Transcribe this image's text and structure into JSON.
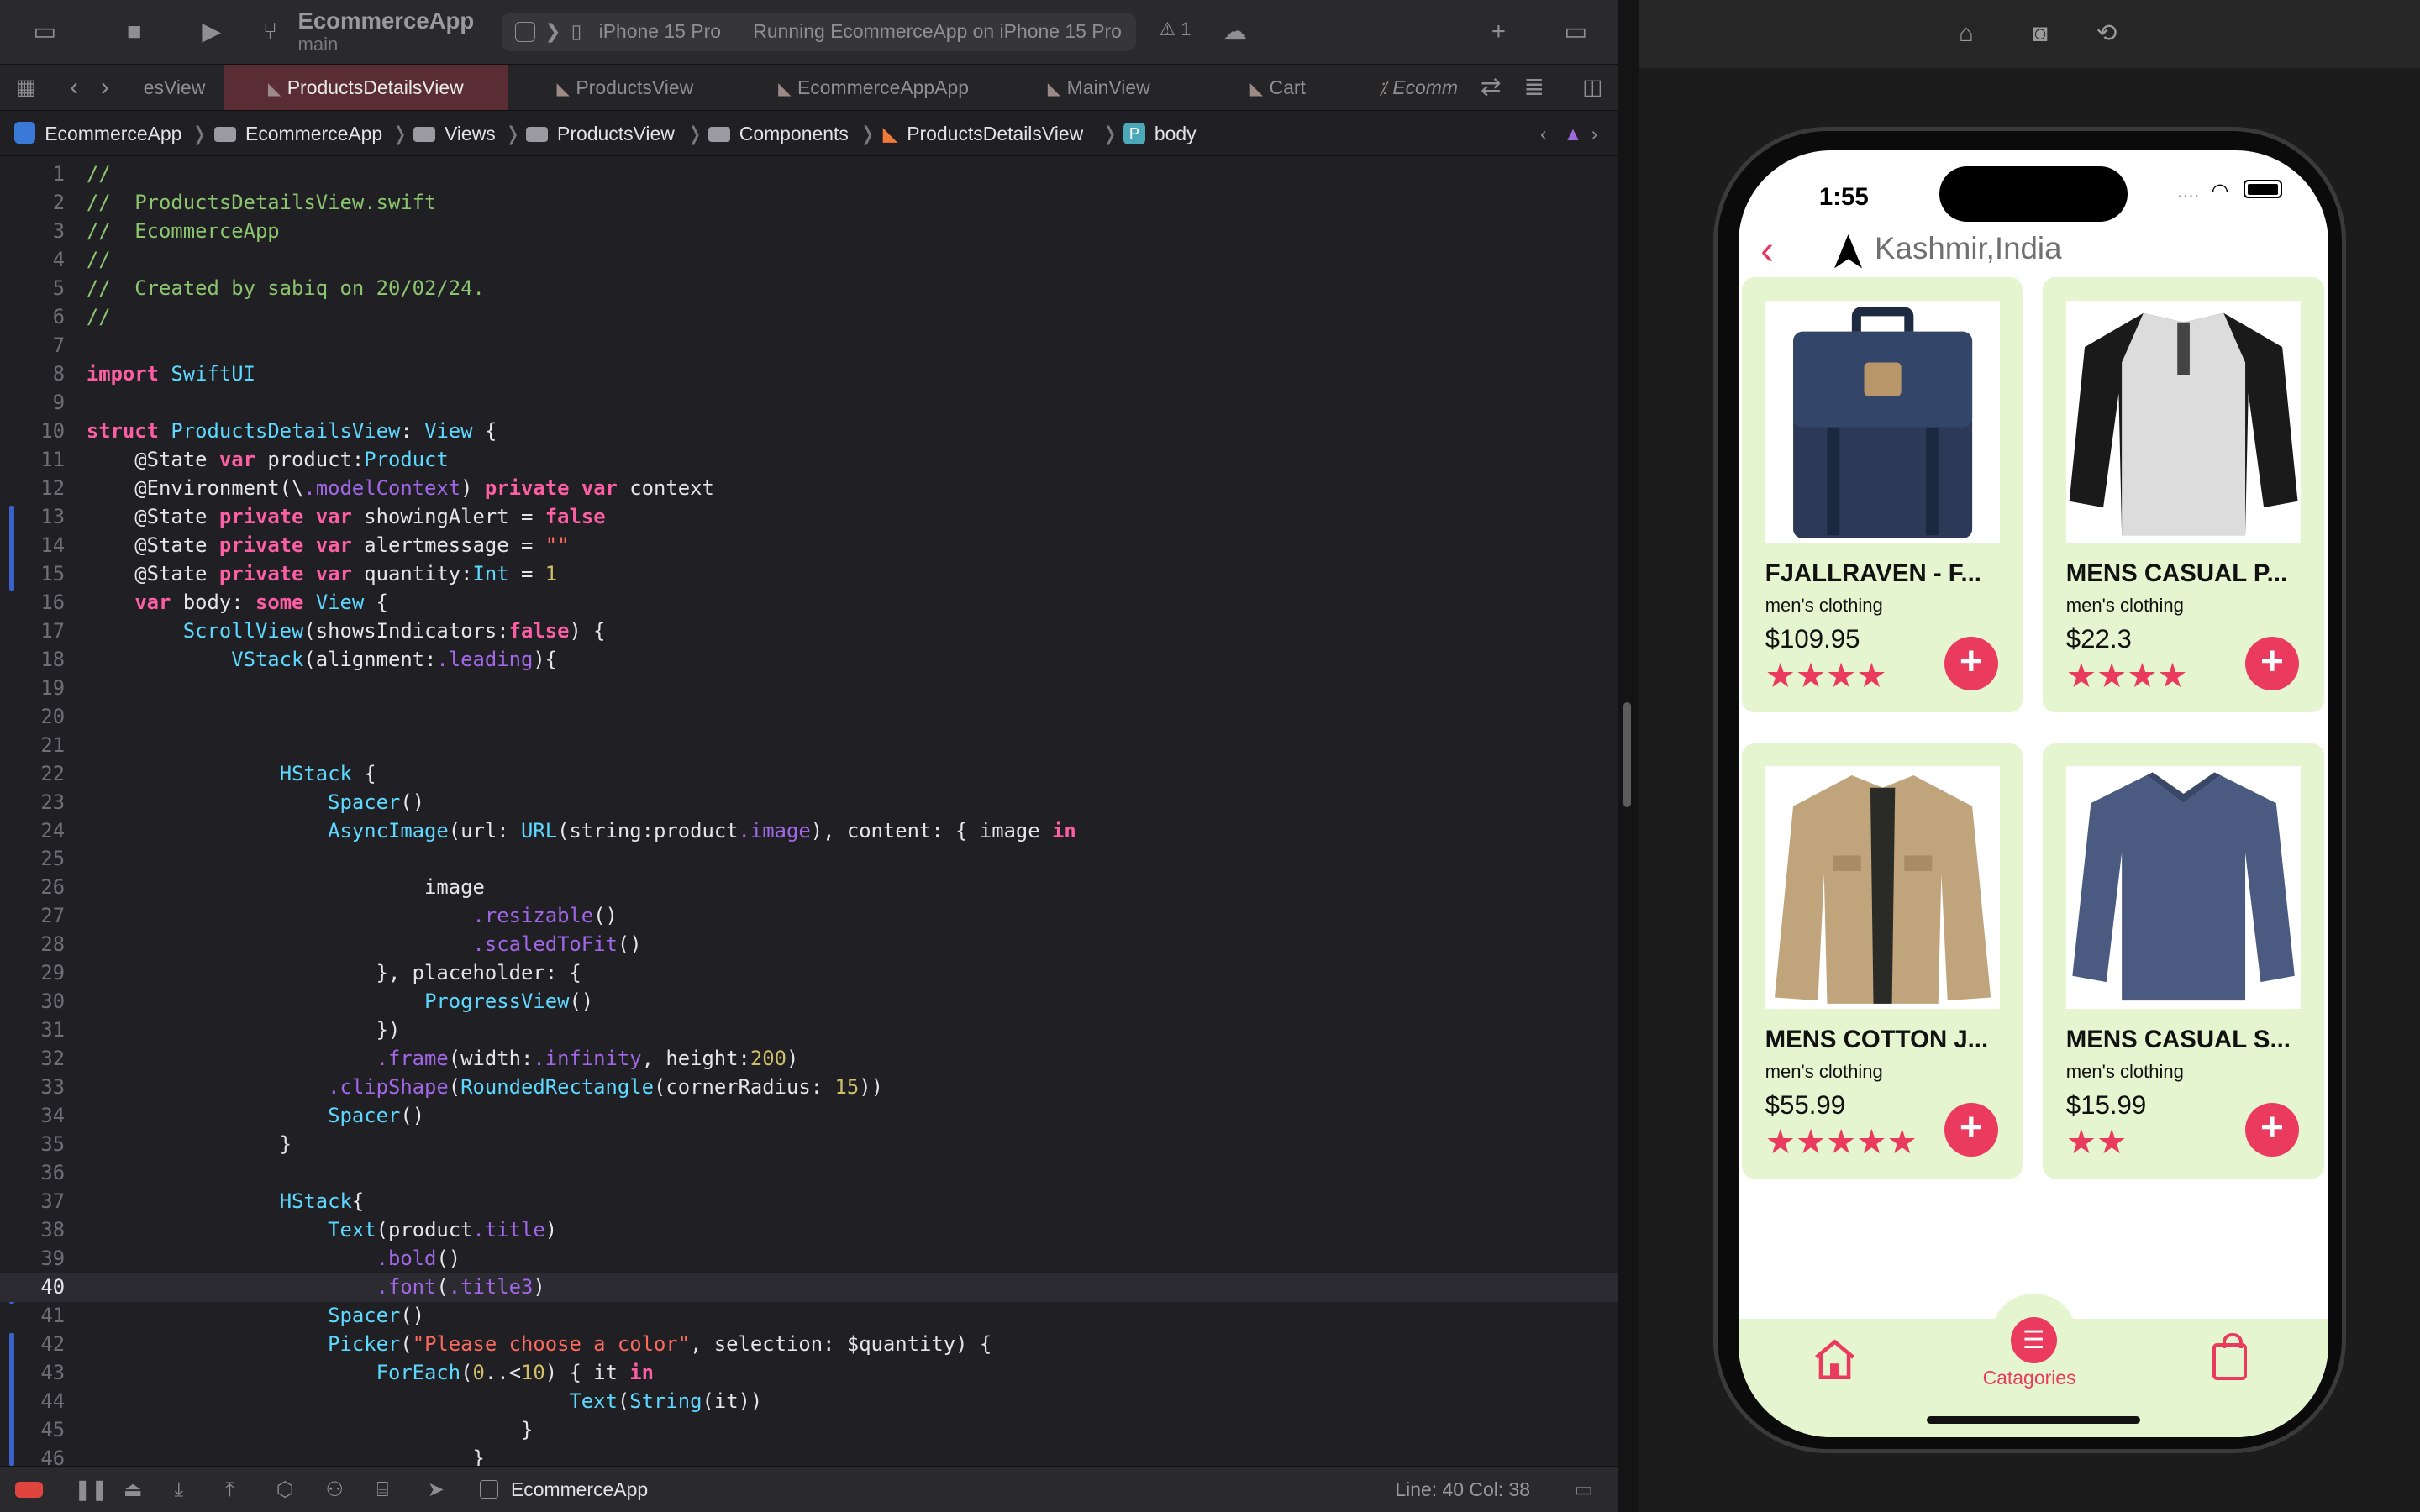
{
  "toolbar": {
    "project_name": "EcommerceApp",
    "branch": "main",
    "scheme_prefix": "❯",
    "device": "iPhone 15 Pro",
    "run_status": "Running EcommerceApp on iPhone 15 Pro",
    "warning_count": "1"
  },
  "tabs": [
    {
      "label": "esView"
    },
    {
      "label": "ProductsDetailsView"
    },
    {
      "label": "ProductsView"
    },
    {
      "label": "EcommerceAppApp"
    },
    {
      "label": "MainView"
    },
    {
      "label": "Cart"
    },
    {
      "label": "Ecomm"
    }
  ],
  "breadcrumbs": [
    "EcommerceApp",
    "EcommerceApp",
    "Views",
    "ProductsView",
    "Components",
    "ProductsDetailsView",
    "body"
  ],
  "breadcrumb_badge": "P",
  "code_lines": [
    "//",
    "//  ProductsDetailsView.swift",
    "//  EcommerceApp",
    "//",
    "//  Created by sabiq on 20/02/24.",
    "//",
    "",
    "import SwiftUI",
    "",
    "struct ProductsDetailsView: View {",
    "    @State var product:Product",
    "    @Environment(\\.modelContext) private var context",
    "    @State private var showingAlert = false",
    "    @State private var alertmessage = \"\"",
    "    @State private var quantity:Int = 1",
    "    var body: some View {",
    "        ScrollView(showsIndicators:false) {",
    "            VStack(alignment:.leading){",
    "",
    "",
    "",
    "                HStack {",
    "                    Spacer()",
    "                    AsyncImage(url: URL(string:product.image), content: { image in",
    "",
    "                            image",
    "                                .resizable()",
    "                                .scaledToFit()",
    "                        }, placeholder: {",
    "                            ProgressView()",
    "                        })",
    "                        .frame(width:.infinity, height:200)",
    "                    .clipShape(RoundedRectangle(cornerRadius: 15))",
    "                    Spacer()",
    "                }",
    "",
    "                HStack{",
    "                    Text(product.title)",
    "                        .bold()",
    "                        .font(.title3)",
    "                    Spacer()",
    "                    Picker(\"Please choose a color\", selection: $quantity) {",
    "                        ForEach(0..<10) { it in",
    "                                        Text(String(it))",
    "                                    }",
    "                                }"
  ],
  "current_line": 40,
  "status": {
    "scheme": "EcommerceApp",
    "position": "Line: 40  Col: 38"
  },
  "colors": {
    "accent": "#ea3b5f",
    "card_bg": "#e4f5d0",
    "keyword": "#fc5fa3",
    "type": "#5dd8ff",
    "comment": "#8bc56e",
    "string": "#fc6a5d",
    "number": "#d0bf69"
  },
  "app": {
    "time": "1:55",
    "signal": "....",
    "location": "Kashmir,India",
    "products": [
      {
        "title": "FJALLRAVEN - F...",
        "category": "men's clothing",
        "price": "$109.95",
        "stars": 4,
        "image": "backpack"
      },
      {
        "title": "MENS CASUAL P...",
        "category": "men's clothing",
        "price": "$22.3",
        "stars": 4,
        "image": "raglan-tshirt"
      },
      {
        "title": "MENS COTTON J...",
        "category": "men's clothing",
        "price": "$55.99",
        "stars": 5,
        "image": "cotton-jacket"
      },
      {
        "title": "MENS CASUAL S...",
        "category": "men's clothing",
        "price": "$15.99",
        "stars": 2,
        "image": "slim-tshirt"
      }
    ],
    "tab_bar": {
      "home_icon": "house-icon",
      "categories_label": "Catagories",
      "categories_icon": "list-icon",
      "cart_icon": "bag-icon"
    }
  }
}
